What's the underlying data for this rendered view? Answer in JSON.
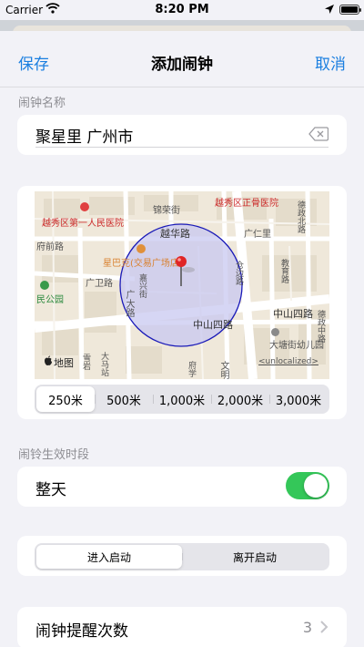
{
  "status": {
    "carrier": "Carrier",
    "time": "8:20 PM"
  },
  "nav": {
    "save": "保存",
    "title": "添加闹钟",
    "cancel": "取消"
  },
  "name_section": {
    "header": "闹钟名称",
    "value": "聚星里 广州市"
  },
  "map": {
    "labels": {
      "jinrong": "锦荣街",
      "zhengguyuan": "越秀区正骨医院",
      "renmin_hospital": "越秀区第一人民医院",
      "yuehua": "越华路",
      "fuqian": "府前路",
      "guangwei": "广卫路",
      "starbucks": "星巴克(交易广场店)",
      "guangdalu": "广大路",
      "renmin_park": "民公园",
      "zhongshan4_a": "中山四路",
      "zhongshan4_b": "中山四路",
      "kindergarten": "大塘街幼儿园",
      "apple_maps": "地图",
      "unlocalized": "<unlocalized>",
      "guangren": "广仁里",
      "dezhengbei": "德政北路",
      "dezhengzhong": "德政中路",
      "jiaoyu": "教育路",
      "wenming": "文明",
      "cangbian": "仓边路",
      "jixing": "嘉兴街",
      "dama": "大马站",
      "fuxue": "府学",
      "xuenan": "雪岩"
    },
    "radius_options": [
      "250米",
      "500米",
      "1,000米",
      "2,000米",
      "3,000米"
    ],
    "selected_radius": "250米"
  },
  "period_section": {
    "header": "闹铃生效时段",
    "all_day": "整天",
    "all_day_on": true
  },
  "trigger": {
    "options": [
      "进入启动",
      "离开启动"
    ],
    "selected": "进入启动"
  },
  "repeat": {
    "label": "闹钟提醒次数",
    "value": "3"
  },
  "colors": {
    "accent": "#1b7fe0",
    "toggle_on": "#34c759",
    "circle_fill": "#c8c8f0",
    "circle_stroke": "#1a1ab8",
    "pin": "#e02525"
  },
  "icons": [
    "wifi-icon",
    "location-arrow-icon",
    "battery-icon",
    "clear-text-icon",
    "map-pin-icon",
    "apple-logo-icon",
    "chevron-right-icon"
  ]
}
